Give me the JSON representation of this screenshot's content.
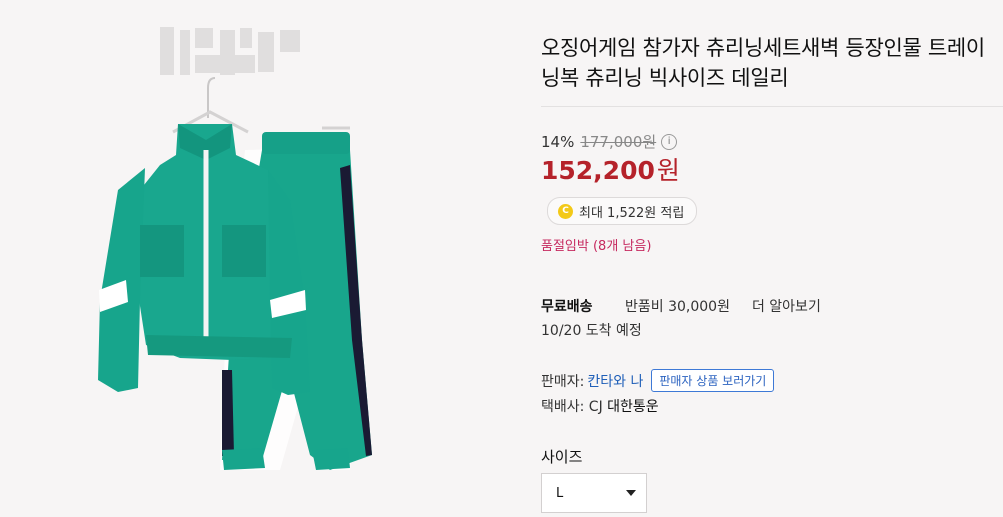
{
  "product": {
    "title": "오징어게임 참가자 츄리닝세트새벽 등장인물 트레이닝복 츄리닝 빅사이즈 데일리",
    "discount": "14%",
    "original_price": "177,000원",
    "sale_price": "152,200",
    "currency_label": "원",
    "reward_coin": "C",
    "reward_text": "최대 1,522원 적립",
    "stock_warning": "품절임박 (8개 남음)"
  },
  "shipping": {
    "label": "무료배송",
    "return_fee": "반품비 30,000원",
    "more_link": "더 알아보기",
    "delivery_date": "10/20 도착 예정"
  },
  "seller": {
    "label": "판매자:",
    "name": "칸타와 나",
    "button": "판매자 상품 보러가기",
    "courier_label": "택배사: CJ",
    "courier_name": "대한통운"
  },
  "options": {
    "size_label": "사이즈",
    "size_value": "L"
  },
  "colors": {
    "garment": "#17a58c",
    "sale_price": "#b5222a",
    "stock_warning": "#c6295f",
    "seller_link": "#1f5fb8"
  },
  "icons": [
    "info-icon",
    "coin-icon",
    "chevron-down-icon"
  ]
}
